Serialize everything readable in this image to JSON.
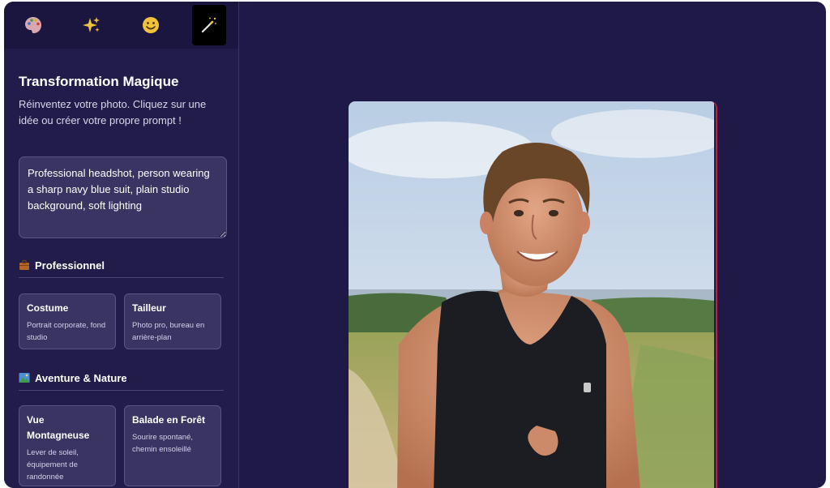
{
  "tabs": [
    {
      "icon": "palette-icon",
      "active": false
    },
    {
      "icon": "sparkles-icon",
      "active": false
    },
    {
      "icon": "smiley-icon",
      "active": false
    },
    {
      "icon": "magic-wand-icon",
      "active": true
    }
  ],
  "panel": {
    "title": "Transformation Magique",
    "subtitle": "Réinventez votre photo. Cliquez sur une idée ou créer votre propre prompt !",
    "prompt_value": "Professional headshot, person wearing a sharp navy blue suit, plain studio background, soft lighting"
  },
  "sections": [
    {
      "icon": "briefcase-icon",
      "label": "Professionnel",
      "cards": [
        {
          "title": "Costume",
          "desc": "Portrait corporate, fond studio"
        },
        {
          "title": "Tailleur",
          "desc": "Photo pro, bureau en arrière-plan"
        }
      ]
    },
    {
      "icon": "landscape-icon",
      "label": "Aventure & Nature",
      "cards": [
        {
          "title": "Vue Montagneuse",
          "desc": "Lever de soleil, équipement de randonnée"
        },
        {
          "title": "Balade en Forêt",
          "desc": "Sourire spontané, chemin ensoleillé"
        }
      ]
    }
  ],
  "photo": {
    "subject": "man-running-photo"
  },
  "colors": {
    "app_bg": "#1e1947",
    "sidebar_bg": "#221c4a",
    "card_bg": "#3a3463",
    "accent_border": "#c21f3a"
  }
}
